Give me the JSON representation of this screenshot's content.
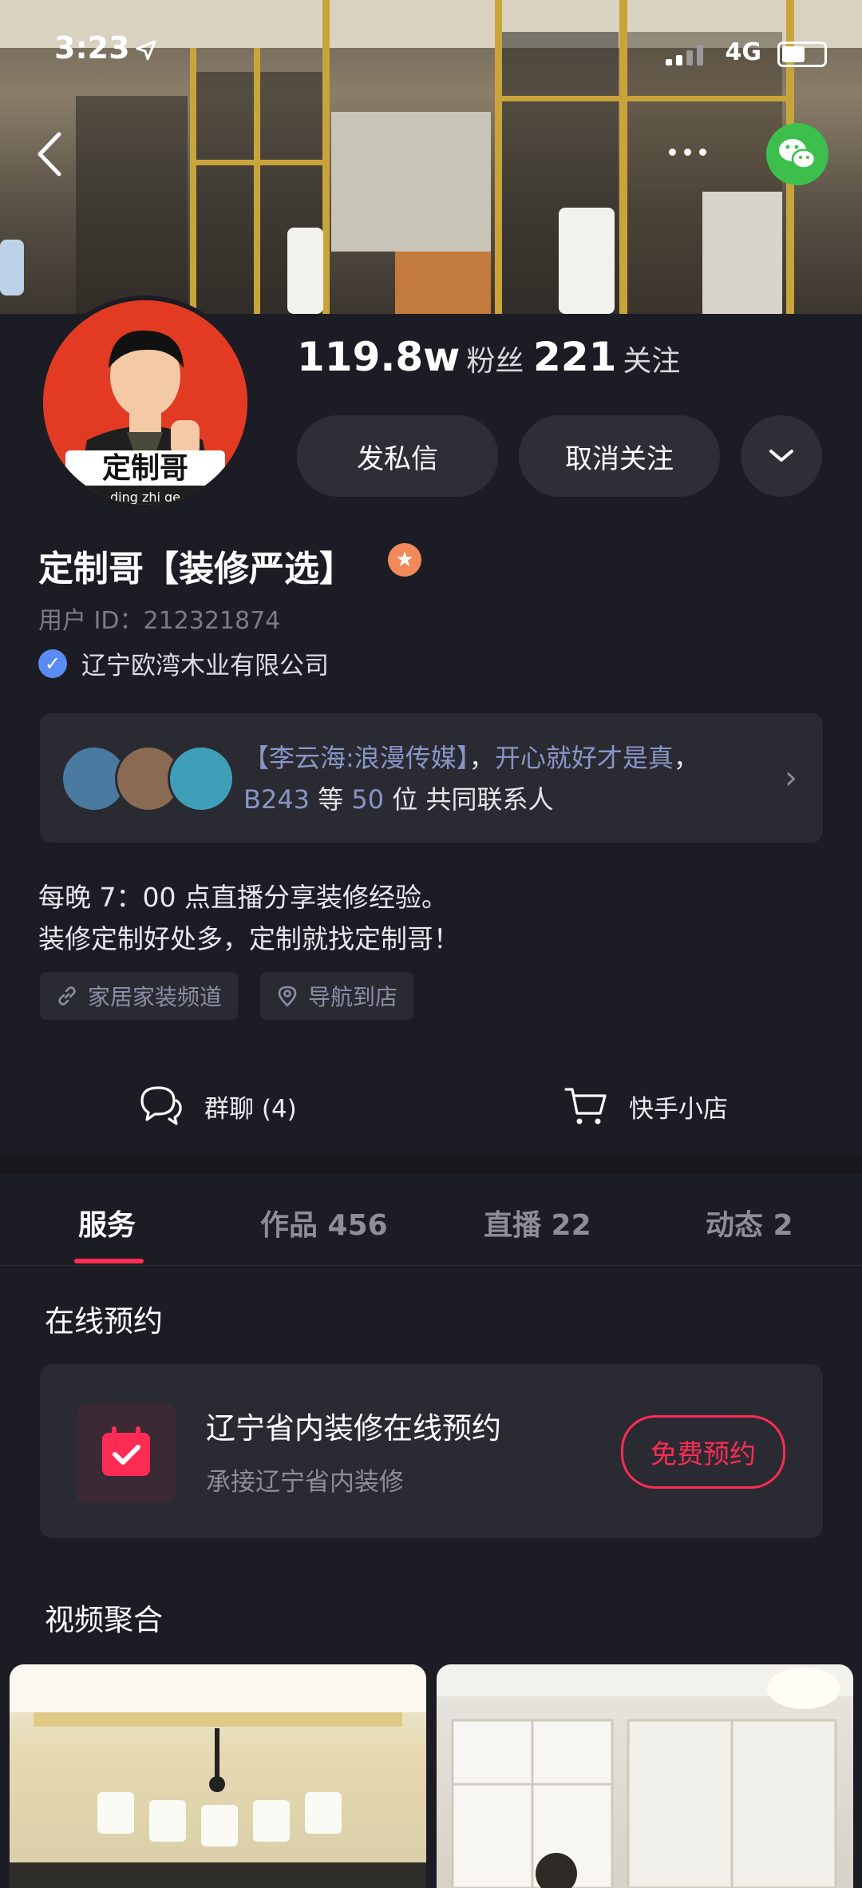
{
  "status_bar": {
    "time": "3:23",
    "network": "4G"
  },
  "header": {
    "more_label": "•••"
  },
  "profile": {
    "avatar_text": "定制哥",
    "avatar_subtext": "ding zhi ge",
    "followers_count": "119.8w",
    "followers_label": "粉丝",
    "following_count": "221",
    "following_label": "关注",
    "message_button": "发私信",
    "unfollow_button": "取消关注",
    "name": "定制哥【装修严选】",
    "user_id": "用户 ID：212321874",
    "verified_company": "辽宁欧湾木业有限公司"
  },
  "contacts": {
    "names": "【李云海:浪漫传媒】",
    "sep": "，",
    "name2": "开心就好才是真",
    "sep2": "，",
    "name3": "B243",
    "middle": " 等 ",
    "count": "50",
    "suffix": " 位 共同联系人"
  },
  "bio": {
    "line1": "每晚 7：00 点直播分享装修经验。",
    "line2": "装修定制好处多，定制就找定制哥！"
  },
  "tags": [
    {
      "label": "家居家装频道"
    },
    {
      "label": "导航到店"
    }
  ],
  "quick_links": {
    "group_chat": "群聊 (4)",
    "shop": "快手小店"
  },
  "tabs": [
    {
      "label": "服务"
    },
    {
      "label": "作品 456"
    },
    {
      "label": "直播 22"
    },
    {
      "label": "动态 2"
    }
  ],
  "booking_section": {
    "title": "在线预约",
    "card_title": "辽宁省内装修在线预约",
    "card_subtitle": "承接辽宁省内装修",
    "button": "免费预约"
  },
  "video_section": {
    "title": "视频聚合"
  },
  "colors": {
    "accent": "#fe2c55",
    "background": "#1c1c24",
    "card": "#2a2a32"
  }
}
